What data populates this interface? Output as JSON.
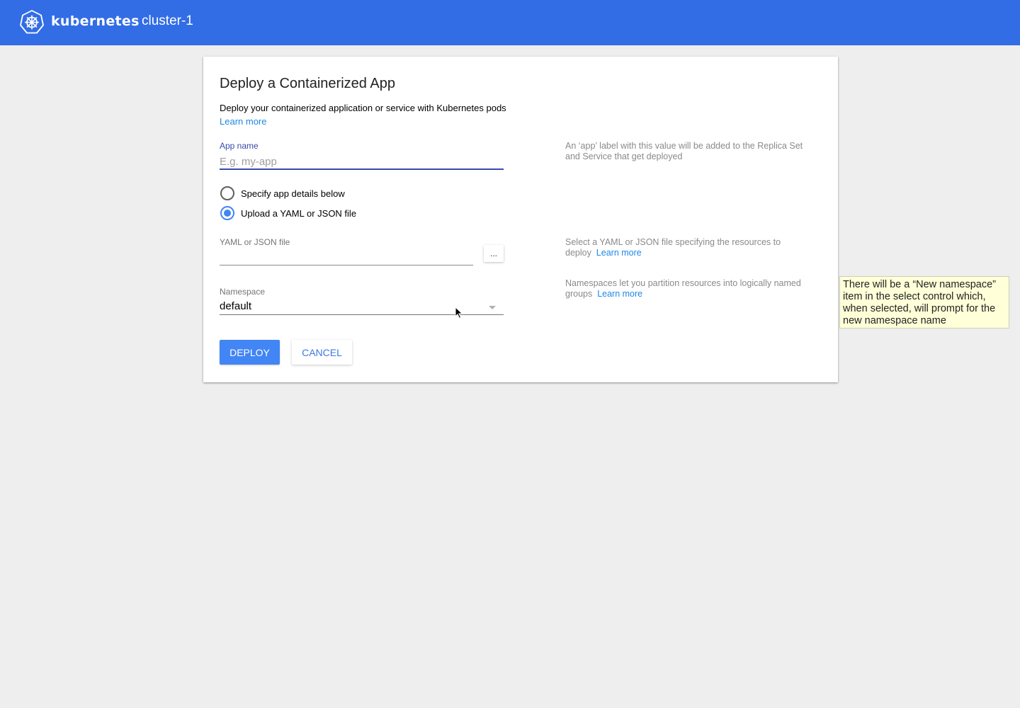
{
  "header": {
    "logo_icon": "kubernetes-helm-icon",
    "brand": "kubernetes",
    "cluster": "cluster-1",
    "bg_color": "#326de6"
  },
  "card": {
    "title": "Deploy a Containerized App",
    "subtitle": "Deploy your containerized application or service with Kubernetes pods",
    "learn_more": "Learn more",
    "app_name": {
      "label": "App name",
      "placeholder": "E.g. my-app",
      "value": "",
      "help": "An ‘app’ label with this value will be added to the Replica Set and Service that get deployed"
    },
    "mode_options": [
      {
        "label": "Specify app details below",
        "checked": false
      },
      {
        "label": "Upload a YAML or JSON file",
        "checked": true
      }
    ],
    "file": {
      "label": "YAML or JSON file",
      "value": "",
      "browse_label": "...",
      "help": "Select a YAML or JSON file specifying the  resources to deploy",
      "help_link": "Learn more"
    },
    "namespace": {
      "label": "Namespace",
      "selected": "default",
      "help": "Namespaces let you partition resources into logically named groups",
      "help_link": "Learn more"
    },
    "deploy_label": "DEPLOY",
    "cancel_label": "CANCEL",
    "accent_color": "#4285f4"
  },
  "annotation": {
    "text": "There will be a “New namespace” item in the select control which, when selected, will prompt for the new namespace name"
  }
}
